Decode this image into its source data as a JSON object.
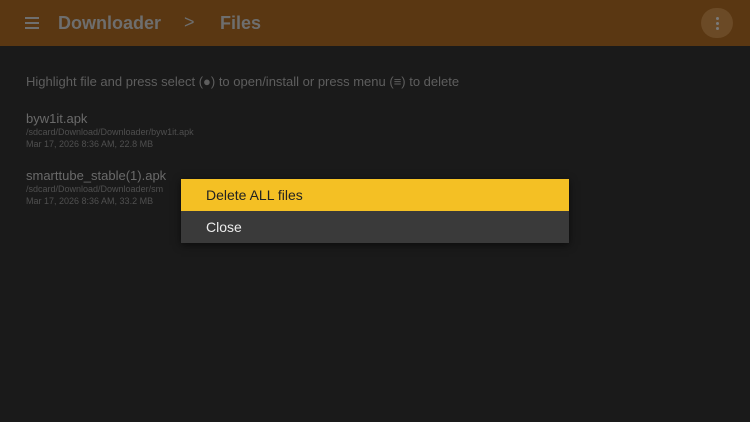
{
  "header": {
    "app_title": "Downloader",
    "separator": ">",
    "section": "Files",
    "menu_icon": "hamburger-menu-icon",
    "overflow_icon": "more-vertical-icon"
  },
  "main": {
    "instructions": "Highlight file and press select (●) to open/install or press menu (≡) to delete",
    "files": [
      {
        "name": "byw1it.apk",
        "path": "/sdcard/Download/Downloader/byw1it.apk",
        "meta": "Mar 17, 2026 8:36 AM, 22.8 MB"
      },
      {
        "name": "smarttube_stable(1).apk",
        "path": "/sdcard/Download/Downloader/sm",
        "meta": "Mar 17, 2026 8:36 AM, 33.2 MB"
      }
    ]
  },
  "dialog": {
    "options": [
      {
        "label": "Delete ALL files",
        "selected": true
      },
      {
        "label": "Close",
        "selected": false
      }
    ]
  },
  "colors": {
    "topbar_dimmed": "#5a3712",
    "background": "#1a1a1a",
    "highlight": "#f4c024",
    "dialog_bg": "#3a3a3a"
  }
}
